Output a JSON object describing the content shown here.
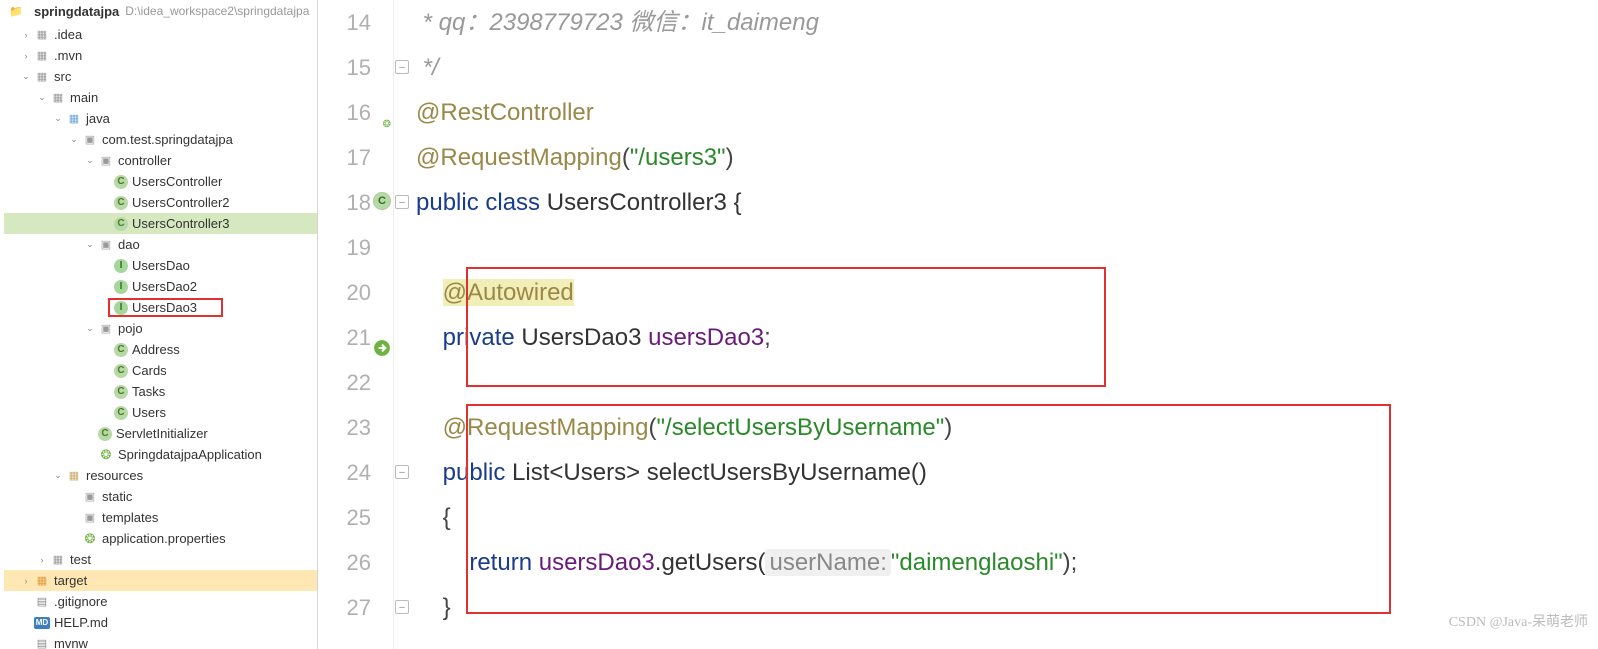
{
  "project": {
    "name": "springdatajpa",
    "path": "D:\\idea_workspace2\\springdatajpa"
  },
  "tree": {
    "idea": ".idea",
    "mvn": ".mvn",
    "src": "src",
    "main": "main",
    "java": "java",
    "pkg": "com.test.springdatajpa",
    "controller": "controller",
    "uc1": "UsersController",
    "uc2": "UsersController2",
    "uc3": "UsersController3",
    "dao": "dao",
    "ud1": "UsersDao",
    "ud2": "UsersDao2",
    "ud3": "UsersDao3",
    "pojo": "pojo",
    "addr": "Address",
    "cards": "Cards",
    "tasks": "Tasks",
    "users": "Users",
    "si": "ServletInitializer",
    "app": "SpringdatajpaApplication",
    "resources": "resources",
    "static": "static",
    "templates": "templates",
    "props": "application.properties",
    "test": "test",
    "target": "target",
    "gitignore": ".gitignore",
    "help": "HELP.md",
    "mvnw": "mvnw"
  },
  "lines": [
    "14",
    "15",
    "16",
    "17",
    "18",
    "19",
    "20",
    "21",
    "22",
    "23",
    "24",
    "25",
    "26",
    "27"
  ],
  "code": {
    "l14_a": " * qq：2398779723 微信：it_daimeng",
    "l15_a": " */",
    "l16_a": "@RestController",
    "l17_a": "@RequestMapping",
    "l17_b": "(",
    "l17_c": "\"/users3\"",
    "l17_d": ")",
    "l18_a": "public class ",
    "l18_b": "UsersController3 {",
    "l20_a": "@Autowired",
    "l21_a": "private ",
    "l21_b": "UsersDao3 ",
    "l21_c": "usersDao3",
    "l21_d": ";",
    "l23_a": "@RequestMapping",
    "l23_b": "(",
    "l23_c": "\"/selectUsersByUsername\"",
    "l23_d": ")",
    "l24_a": "public ",
    "l24_b": "List<Users> selectUsersByUsername()",
    "l25_a": "{",
    "l26_a": "return ",
    "l26_b": "usersDao3",
    "l26_c": ".getUsers(",
    "l26_d": "userName:",
    "l26_e": "\"daimenglaoshi\"",
    "l26_f": ");",
    "l27_a": "}"
  },
  "watermark": "CSDN @Java-呆萌老师"
}
